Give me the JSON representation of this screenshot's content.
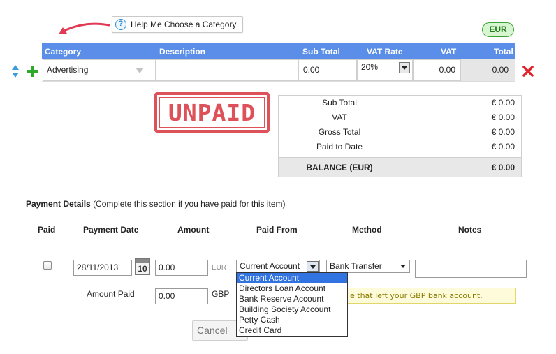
{
  "help": {
    "label": "Help Me Choose a Category"
  },
  "currency": "EUR",
  "item_table": {
    "headers": [
      "Category",
      "Description",
      "Sub Total",
      "VAT Rate",
      "VAT",
      "Total"
    ],
    "row": {
      "category": "Advertising",
      "description": "",
      "sub_total": "0.00",
      "vat_rate": "20%",
      "vat": "0.00",
      "total": "0.00"
    }
  },
  "unpaid_stamp": "UNPAID",
  "summary": {
    "rows": [
      {
        "label": "Sub Total",
        "value": "€ 0.00"
      },
      {
        "label": "VAT",
        "value": "€ 0.00"
      },
      {
        "label": "Gross Total",
        "value": "€ 0.00"
      },
      {
        "label": "Paid to Date",
        "value": "€ 0.00"
      }
    ],
    "balance": {
      "label": "BALANCE (EUR)",
      "value": "€ 0.00"
    }
  },
  "payment": {
    "title": "Payment Details",
    "subtitle": "(Complete this section if you have paid for this item)",
    "headers": [
      "Paid",
      "Payment Date",
      "Amount",
      "Paid From",
      "Method",
      "Notes"
    ],
    "date": "28/11/2013",
    "calendar_day": "10",
    "amount": "0.00",
    "amount_currency": "EUR",
    "paid_from": "Current Account",
    "method": "Bank Transfer",
    "notes": "",
    "amount_paid_label": "Amount Paid",
    "amount_paid": "0.00",
    "amount_paid_currency": "GBP",
    "paid_from_options": [
      "Current Account",
      "Directors Loan Account",
      "Bank Reserve Account",
      "Building Society Account",
      "Petty Cash",
      "Credit Card"
    ],
    "hint": "e that left your GBP bank account.",
    "cancel_label": "Cancel"
  },
  "colors": {
    "header_blue": "#5a8ee8",
    "stamp_red": "#d8343c",
    "badge_green": "#3aa135",
    "selection_blue": "#3173e0"
  }
}
